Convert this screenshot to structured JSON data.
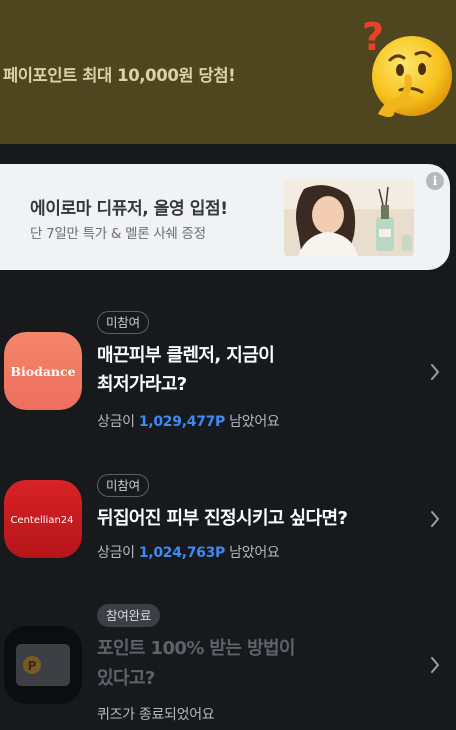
{
  "top_banner": {
    "text": "페이포인트 최대 10,000원 당첨!",
    "icon": "thinking-face-icon"
  },
  "ad": {
    "title": "에이로마 디퓨저, 올영 입점!",
    "subtitle": "단 7일만 특가 & 멜론 사쉐 증정",
    "info_icon": "i"
  },
  "quizzes": [
    {
      "brand": "Biodance",
      "status": "미참여",
      "title_line1": "매끈피부 클렌저, 지금이",
      "title_line2": "최저가라고?",
      "prize_prefix": "상금이",
      "prize_amount": "1,029,477P",
      "prize_suffix": "남았어요"
    },
    {
      "brand": "Centellian24",
      "status": "미참여",
      "title_line1": "뒤집어진 피부 진정시키고 싶다면?",
      "prize_prefix": "상금이",
      "prize_amount": "1,024,763P",
      "prize_suffix": "남았어요"
    },
    {
      "brand": "P",
      "status": "참여완료",
      "title_line1": "포인트 100% 받는 방법이",
      "title_line2": "있다고?",
      "ended_text": "퀴즈가 종료되었어요"
    }
  ],
  "colors": {
    "page_background": "#17191c",
    "banner_background": "#4f4620",
    "prize_accent": "#3d8bf2",
    "biodance_brand": "#f07a63",
    "centellian_brand": "#c81e22"
  }
}
